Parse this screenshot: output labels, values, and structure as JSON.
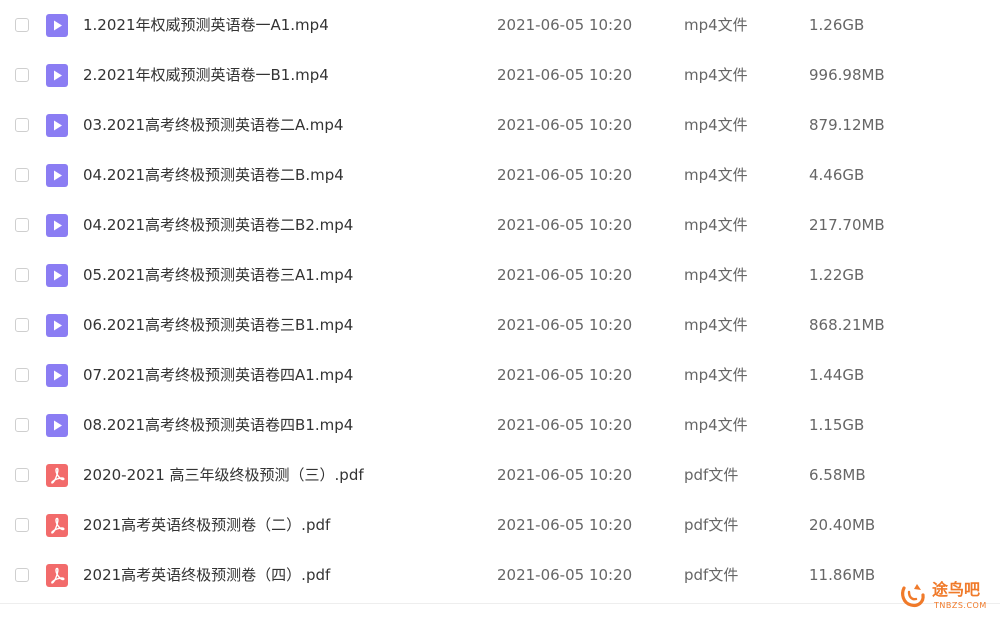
{
  "files": [
    {
      "name": "1.2021年权威预测英语卷一A1.mp4",
      "date": "2021-06-05 10:20",
      "type": "mp4文件",
      "size": "1.26GB",
      "icon": "video-file-icon"
    },
    {
      "name": "2.2021年权威预测英语卷一B1.mp4",
      "date": "2021-06-05 10:20",
      "type": "mp4文件",
      "size": "996.98MB",
      "icon": "video-file-icon"
    },
    {
      "name": "03.2021高考终极预测英语卷二A.mp4",
      "date": "2021-06-05 10:20",
      "type": "mp4文件",
      "size": "879.12MB",
      "icon": "video-file-icon"
    },
    {
      "name": "04.2021高考终极预测英语卷二B.mp4",
      "date": "2021-06-05 10:20",
      "type": "mp4文件",
      "size": "4.46GB",
      "icon": "video-file-icon"
    },
    {
      "name": "04.2021高考终极预测英语卷二B2.mp4",
      "date": "2021-06-05 10:20",
      "type": "mp4文件",
      "size": "217.70MB",
      "icon": "video-file-icon"
    },
    {
      "name": "05.2021高考终极预测英语卷三A1.mp4",
      "date": "2021-06-05 10:20",
      "type": "mp4文件",
      "size": "1.22GB",
      "icon": "video-file-icon"
    },
    {
      "name": "06.2021高考终极预测英语卷三B1.mp4",
      "date": "2021-06-05 10:20",
      "type": "mp4文件",
      "size": "868.21MB",
      "icon": "video-file-icon"
    },
    {
      "name": "07.2021高考终极预测英语卷四A1.mp4",
      "date": "2021-06-05 10:20",
      "type": "mp4文件",
      "size": "1.44GB",
      "icon": "video-file-icon"
    },
    {
      "name": "08.2021高考终极预测英语卷四B1.mp4",
      "date": "2021-06-05 10:20",
      "type": "mp4文件",
      "size": "1.15GB",
      "icon": "video-file-icon"
    },
    {
      "name": "2020-2021 高三年级终极预测（三）.pdf",
      "date": "2021-06-05 10:20",
      "type": "pdf文件",
      "size": "6.58MB",
      "icon": "pdf-file-icon"
    },
    {
      "name": "2021高考英语终极预测卷（二）.pdf",
      "date": "2021-06-05 10:20",
      "type": "pdf文件",
      "size": "20.40MB",
      "icon": "pdf-file-icon"
    },
    {
      "name": "2021高考英语终极预测卷（四）.pdf",
      "date": "2021-06-05 10:20",
      "type": "pdf文件",
      "size": "11.86MB",
      "icon": "pdf-file-icon"
    }
  ],
  "watermark": {
    "title": "途鸟吧",
    "subtitle": "TNBZS.COM"
  },
  "colors": {
    "video_icon": "#8b7df3",
    "pdf_icon": "#f26b6b",
    "watermark": "#f07a2a"
  }
}
